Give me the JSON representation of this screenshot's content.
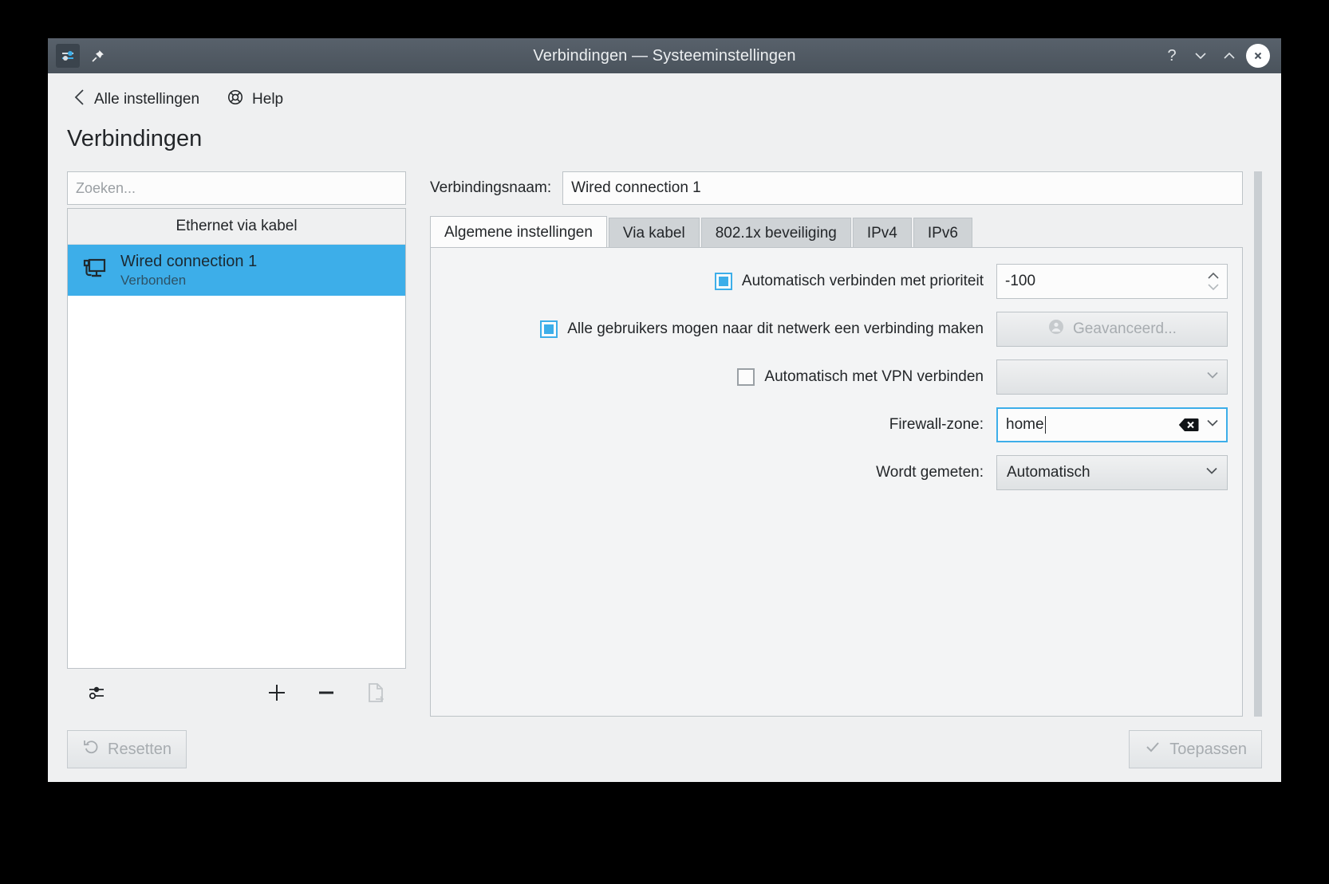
{
  "window": {
    "title": "Verbindingen — Systeeminstellingen",
    "app_icon": "settings-sliders-icon",
    "pin_icon": "pin-icon",
    "help_button": "?",
    "minimize_button": "minimize-icon",
    "maximize_button": "maximize-icon",
    "close_button": "close-icon",
    "titlebar_color": "#4a535c",
    "accent_color": "#3daee9"
  },
  "header": {
    "back_label": "Alle instellingen",
    "help_label": "Help",
    "page_title": "Verbindingen"
  },
  "sidebar": {
    "search_placeholder": "Zoeken...",
    "search_value": "",
    "group_label": "Ethernet via kabel",
    "connections": [
      {
        "name": "Wired connection 1",
        "status": "Verbonden",
        "icon": "wired-network-icon",
        "selected": true
      }
    ],
    "tools": {
      "configure": "configure-sliders-icon",
      "add": "plus-icon",
      "remove": "minus-icon",
      "export": "export-document-icon"
    }
  },
  "main": {
    "connection_name_label": "Verbindingsnaam:",
    "connection_name_value": "Wired connection 1",
    "tabs": [
      {
        "label": "Algemene instellingen",
        "active": true
      },
      {
        "label": "Via kabel",
        "active": false
      },
      {
        "label": "802.1x beveiliging",
        "active": false
      },
      {
        "label": "IPv4",
        "active": false
      },
      {
        "label": "IPv6",
        "active": false
      }
    ],
    "general": {
      "autoconnect": {
        "label": "Automatisch verbinden met prioriteit",
        "checked": true,
        "priority_value": "-100"
      },
      "all_users": {
        "label": "Alle gebruikers mogen naar dit netwerk een verbinding maken",
        "checked": true,
        "advanced_button": "Geavanceerd...",
        "advanced_icon": "user-icon",
        "advanced_disabled": true
      },
      "vpn": {
        "label": "Automatisch met VPN verbinden",
        "checked": false,
        "dropdown_value": "",
        "dropdown_disabled": true
      },
      "firewall": {
        "label": "Firewall-zone:",
        "value": "home",
        "focused": true,
        "clear_icon": "clear-backspace-icon",
        "dropdown_icon": "chevron-down-icon"
      },
      "metered": {
        "label": "Wordt gemeten:",
        "value": "Automatisch",
        "dropdown_icon": "chevron-down-icon"
      }
    }
  },
  "footer": {
    "reset_label": "Resetten",
    "reset_icon": "undo-icon",
    "reset_disabled": true,
    "apply_label": "Toepassen",
    "apply_icon": "check-icon",
    "apply_disabled": true
  }
}
